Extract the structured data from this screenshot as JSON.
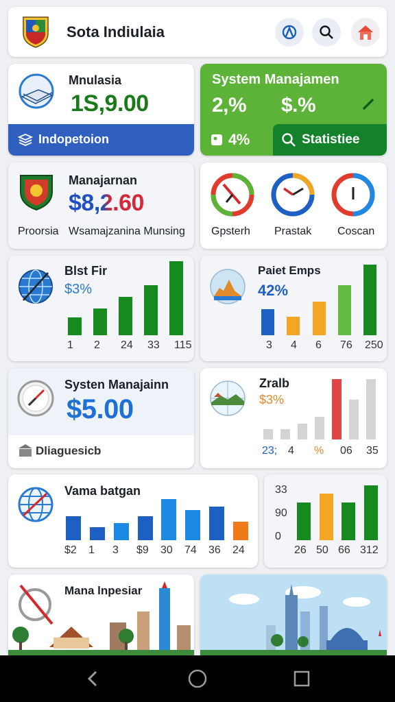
{
  "header": {
    "title": "Sota Indiulaia",
    "icons": [
      "crest-logo-icon",
      "compass-icon",
      "search-icon",
      "house-icon"
    ]
  },
  "card1": {
    "title": "Mnulasia",
    "value": "1S,9.00",
    "footer_label": "Indopetoion",
    "colors": {
      "value": "#1a7a1a",
      "footer": "#2f5fbf"
    }
  },
  "card2": {
    "title": "System Manajamen",
    "stat1": "2,%",
    "stat2": "$.%",
    "stat3": "4%",
    "button_label": "Statistiee",
    "colors": {
      "bg": "#5cb337",
      "button": "#13822b"
    }
  },
  "card3": {
    "title": "Manajarnan",
    "value": "$8,2.60",
    "label_left": "Proorsia",
    "label_right": "Wsamajzanina Munsing"
  },
  "card4": {
    "gauges": [
      {
        "label": "Gpsterh"
      },
      {
        "label": "Prastak"
      },
      {
        "label": "Coscan"
      }
    ]
  },
  "card5": {
    "title": "Blst Fir",
    "subtitle": "$3%",
    "chart_data": {
      "type": "bar",
      "categories": [
        "1",
        "2",
        "24",
        "33",
        "115"
      ],
      "values": [
        12,
        18,
        26,
        34,
        50
      ]
    }
  },
  "card6": {
    "title": "Paiet Emps",
    "subtitle": "42%",
    "chart_data": {
      "type": "bar",
      "categories": [
        "3",
        "4",
        "6",
        "76",
        "250"
      ],
      "values": [
        14,
        10,
        18,
        27,
        38
      ],
      "colors": [
        "#1e5fc4",
        "#f2a623",
        "#f2a623",
        "#66bb44",
        "#168a1f"
      ]
    }
  },
  "card7": {
    "title": "Systen Manajainn",
    "value": "$5.00",
    "footer_label": "Dliaguesicb"
  },
  "card8": {
    "title": "Zralb",
    "subtitle": "$3%",
    "chart_data": {
      "type": "bar",
      "categories": [
        "23;",
        "4",
        "%",
        "06",
        "35"
      ],
      "values": [
        8,
        8,
        12,
        17,
        46,
        30,
        46
      ]
    }
  },
  "card9": {
    "title": "Vama batgan",
    "chart_data": {
      "type": "bar",
      "categories": [
        "$2",
        "1",
        "3",
        "$9",
        "30",
        "74",
        "36",
        "24"
      ],
      "values": [
        13,
        7,
        9,
        13,
        22,
        16,
        18,
        10
      ]
    }
  },
  "card10": {
    "y_ticks": [
      "33",
      "90",
      "0"
    ],
    "chart_data": {
      "type": "bar",
      "categories": [
        "26",
        "50",
        "66",
        "312"
      ],
      "values": [
        24,
        30,
        24,
        35
      ],
      "colors": [
        "#168a1f",
        "#f2a623",
        "#168a1f",
        "#168a1f"
      ]
    }
  },
  "card11": {
    "title": "Mana lnpesiar"
  },
  "navigation": {
    "back": "back-icon",
    "home": "home-icon",
    "recents": "recents-icon"
  }
}
